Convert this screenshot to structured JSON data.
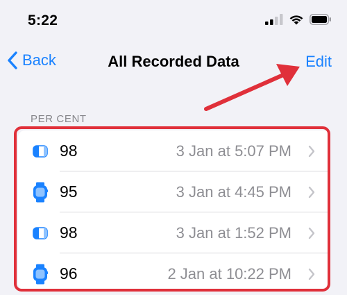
{
  "status_bar": {
    "time": "5:22"
  },
  "nav": {
    "back_label": "Back",
    "title": "All Recorded Data",
    "edit_label": "Edit"
  },
  "section": {
    "header": "PER CENT"
  },
  "rows": [
    {
      "value": "98",
      "time": "3 Jan at 5:07 PM",
      "icon": "airpods-case-icon"
    },
    {
      "value": "95",
      "time": "3 Jan at 4:45 PM",
      "icon": "apple-watch-icon"
    },
    {
      "value": "98",
      "time": "3 Jan at 1:52 PM",
      "icon": "airpods-case-icon"
    },
    {
      "value": "96",
      "time": "2 Jan at 10:22 PM",
      "icon": "apple-watch-icon"
    }
  ],
  "colors": {
    "accent": "#1a82ff",
    "annotation": "#e0303a",
    "background": "#f2f2f7"
  }
}
